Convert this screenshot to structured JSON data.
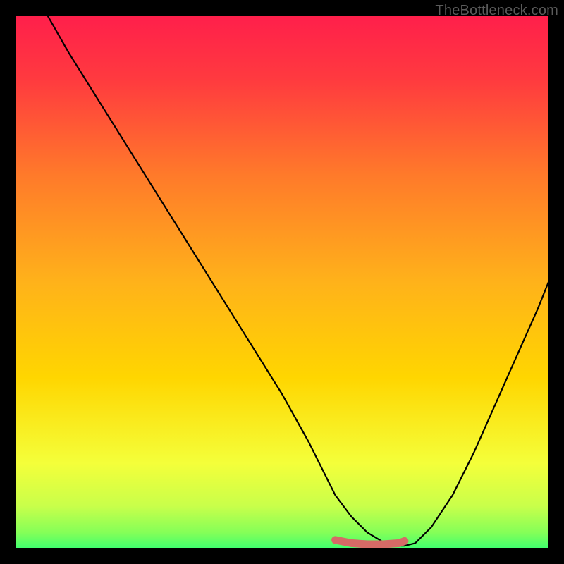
{
  "watermark": "TheBottleneck.com",
  "chart_data": {
    "type": "line",
    "title": "",
    "xlabel": "",
    "ylabel": "",
    "xlim": [
      0,
      100
    ],
    "ylim": [
      0,
      100
    ],
    "grid": false,
    "legend": false,
    "background_gradient": {
      "top_color": "#ff1f4b",
      "mid_color": "#ffd600",
      "bottom_color": "#3fff6e"
    },
    "series": [
      {
        "name": "bottleneck-curve",
        "color": "#000000",
        "x": [
          6,
          10,
          15,
          20,
          25,
          30,
          35,
          40,
          45,
          50,
          55,
          58,
          60,
          63,
          66,
          69,
          72,
          73,
          75,
          78,
          82,
          86,
          90,
          94,
          98,
          100
        ],
        "y": [
          100,
          93,
          85,
          77,
          69,
          61,
          53,
          45,
          37,
          29,
          20,
          14,
          10,
          6,
          3,
          1.2,
          0.5,
          0.5,
          1,
          4,
          10,
          18,
          27,
          36,
          45,
          50
        ]
      },
      {
        "name": "minimum-marker",
        "color": "#d66a66",
        "type": "segment",
        "x": [
          60,
          63,
          66,
          69,
          72,
          73
        ],
        "y": [
          1.6,
          1.0,
          0.8,
          0.8,
          1.0,
          1.4
        ]
      }
    ]
  }
}
